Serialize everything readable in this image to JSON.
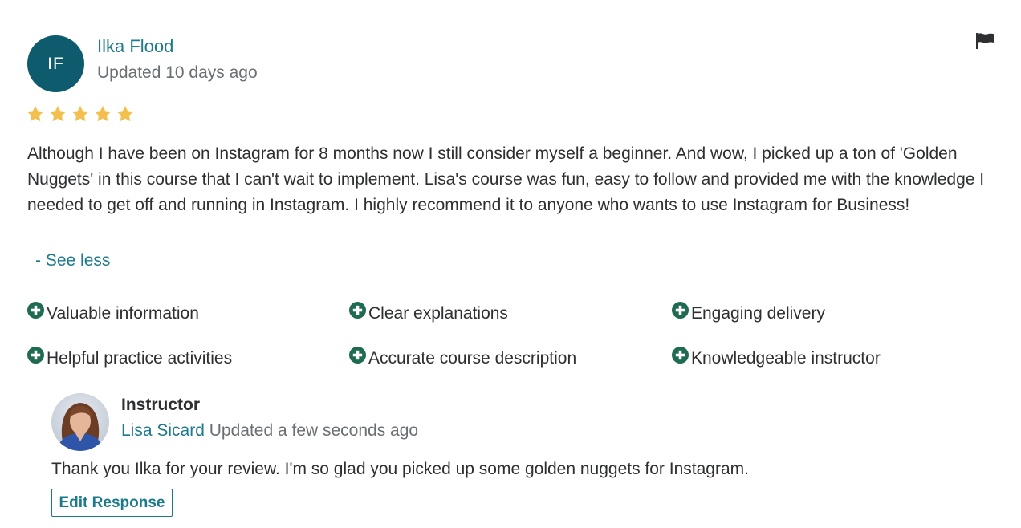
{
  "review": {
    "avatar_initials": "IF",
    "reviewer_name": "Ilka Flood",
    "updated": "Updated 10 days ago",
    "rating": 5,
    "rating_max": 5,
    "text": "Although I have been on Instagram for 8 months now I still consider myself a beginner. And wow, I picked up a ton of 'Golden Nuggets' in this course that I can't wait to implement. Lisa's course was fun, easy to follow and provided me with the knowledge I needed to get off and running in Instagram. I highly recommend it to anyone who wants to use Instagram for Business!",
    "see_less_label": "- See less",
    "tags": [
      "Valuable information",
      "Clear explanations",
      "Engaging delivery",
      "Helpful practice activities",
      "Accurate course description",
      "Knowledgeable instructor"
    ]
  },
  "response": {
    "role_label": "Instructor",
    "instructor_name": "Lisa Sicard",
    "updated": "Updated a few seconds ago",
    "text": "Thank you Ilka for your review. I'm so glad you picked up some golden nuggets for Instagram.",
    "edit_button_label": "Edit Response"
  },
  "icons": {
    "flag": "flag-icon",
    "star": "star-icon",
    "tag": "plus-circle-icon"
  },
  "colors": {
    "accent": "#1c7a8c",
    "avatar_bg": "#0f5b6e",
    "star": "#f3c04f",
    "tag_icon": "#1e6b52",
    "muted_text": "#6a6f73",
    "body_text": "#2d2f31"
  }
}
